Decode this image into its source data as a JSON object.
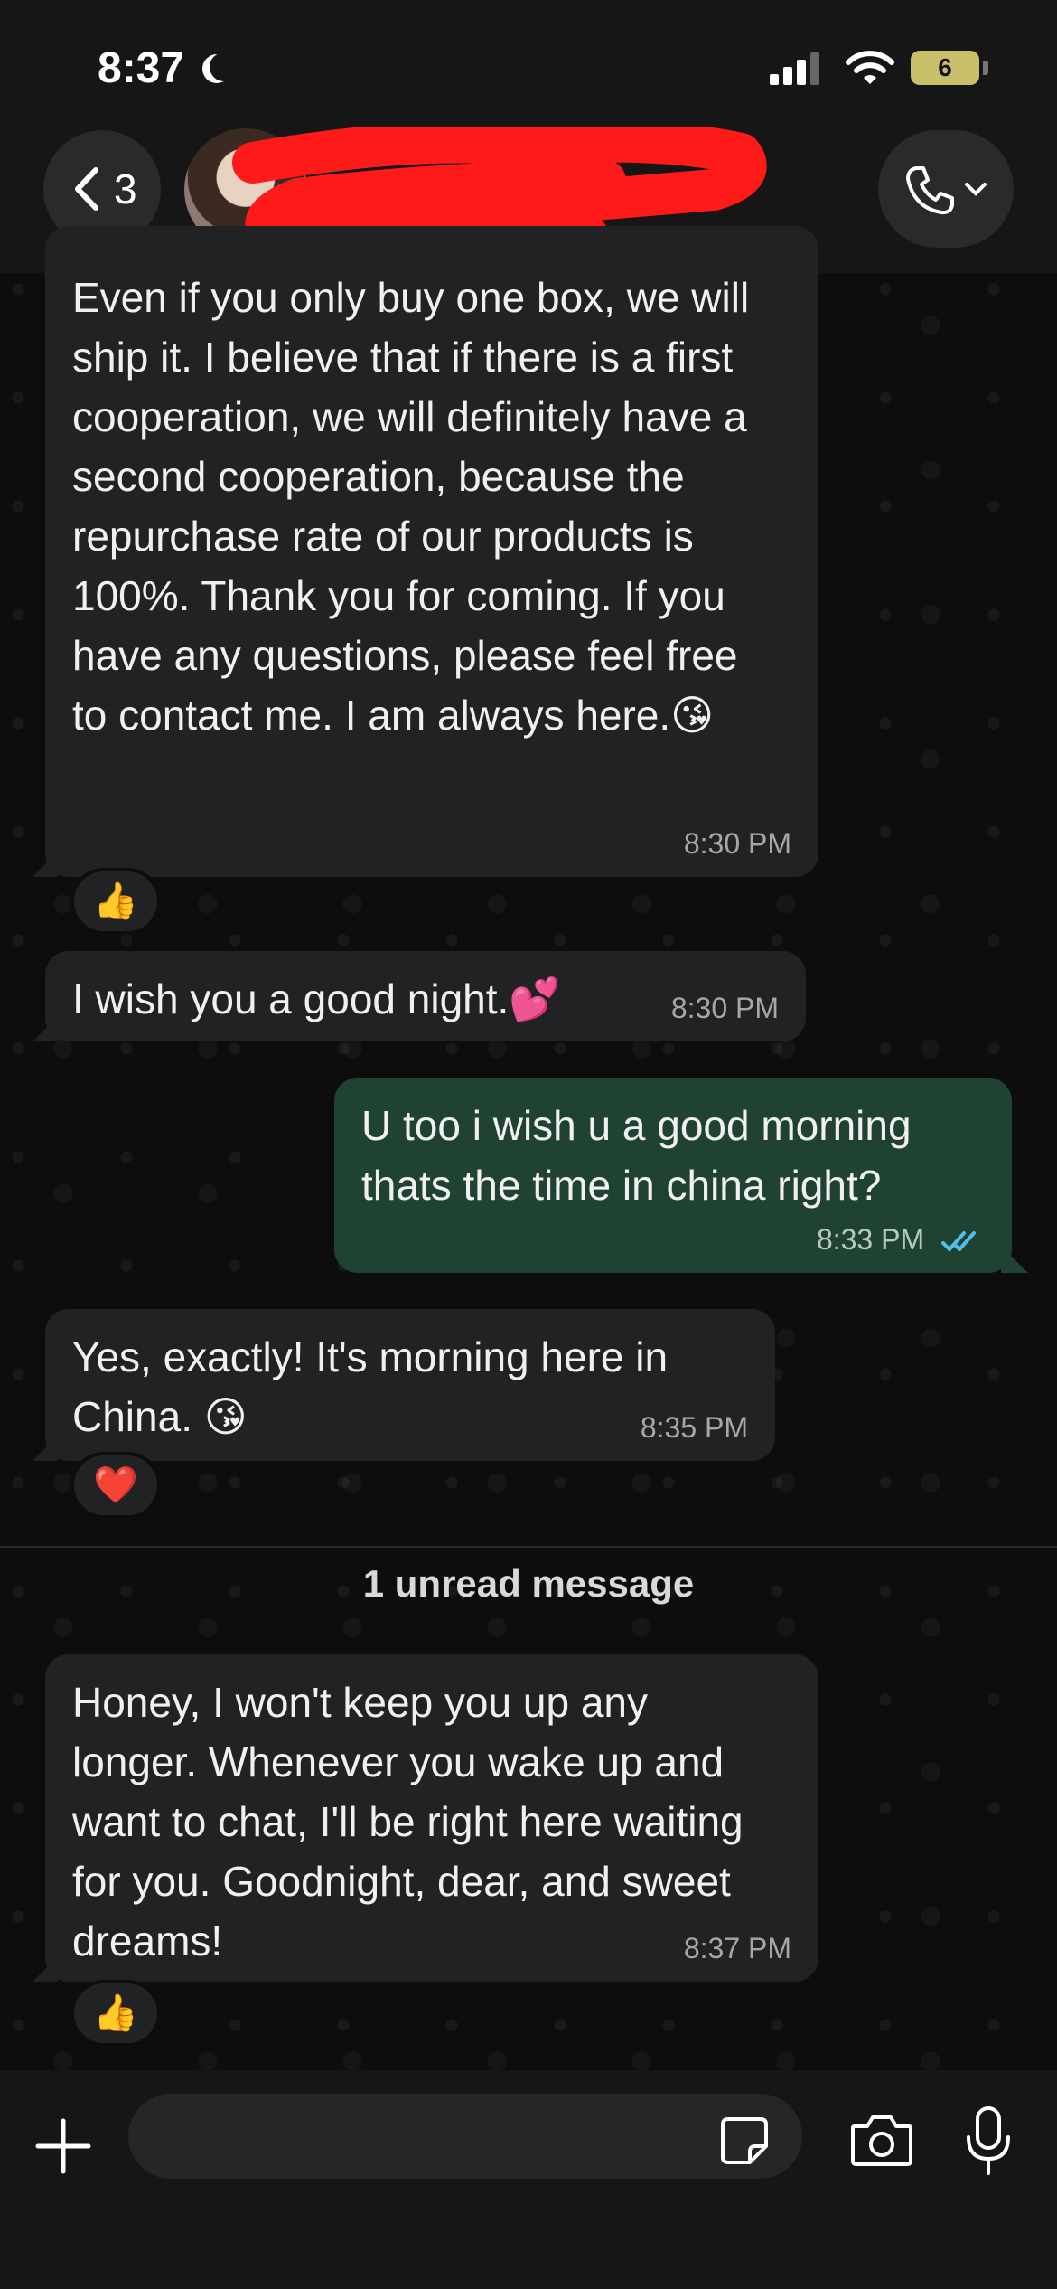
{
  "status_bar": {
    "time": "8:37",
    "battery": "6",
    "moon_icon": "moon-icon",
    "signal_icon": "signal-icon",
    "wifi_icon": "wifi-icon"
  },
  "header": {
    "back_count": "3",
    "contact_name_redacted": true,
    "call_icon": "phone-icon"
  },
  "messages": [
    {
      "direction": "in",
      "text": "Even if you only buy one box, we will ship it. I believe that if there is a first cooperation, we will definitely have a second cooperation, because the repurchase rate of our products is 100%. Thank you for coming. If you have any questions, please feel free to contact me. I am always here.😘",
      "time": "8:30 PM",
      "reaction": "👍"
    },
    {
      "direction": "in",
      "text": "I wish you a good night.💕",
      "time": "8:30 PM"
    },
    {
      "direction": "out",
      "text": "U too i wish u a good morning thats the time in china right?",
      "time": "8:33 PM",
      "status": "read"
    },
    {
      "direction": "in",
      "text": "Yes, exactly! It's morning here in China. 😘",
      "time": "8:35 PM",
      "reaction": "❤️"
    },
    {
      "direction": "in",
      "text": "Honey, I won't keep you up any longer. Whenever you wake up and want to chat, I'll be right here waiting for you. Goodnight, dear, and sweet dreams!",
      "time": "8:37 PM",
      "reaction": "👍"
    }
  ],
  "unread_divider": "1 unread message",
  "input": {
    "placeholder": "",
    "value": ""
  },
  "colors": {
    "incoming_bubble": "#212224",
    "outgoing_bubble": "#1f4233",
    "read_ticks": "#53bdeb",
    "background": "#0d0d0d"
  }
}
